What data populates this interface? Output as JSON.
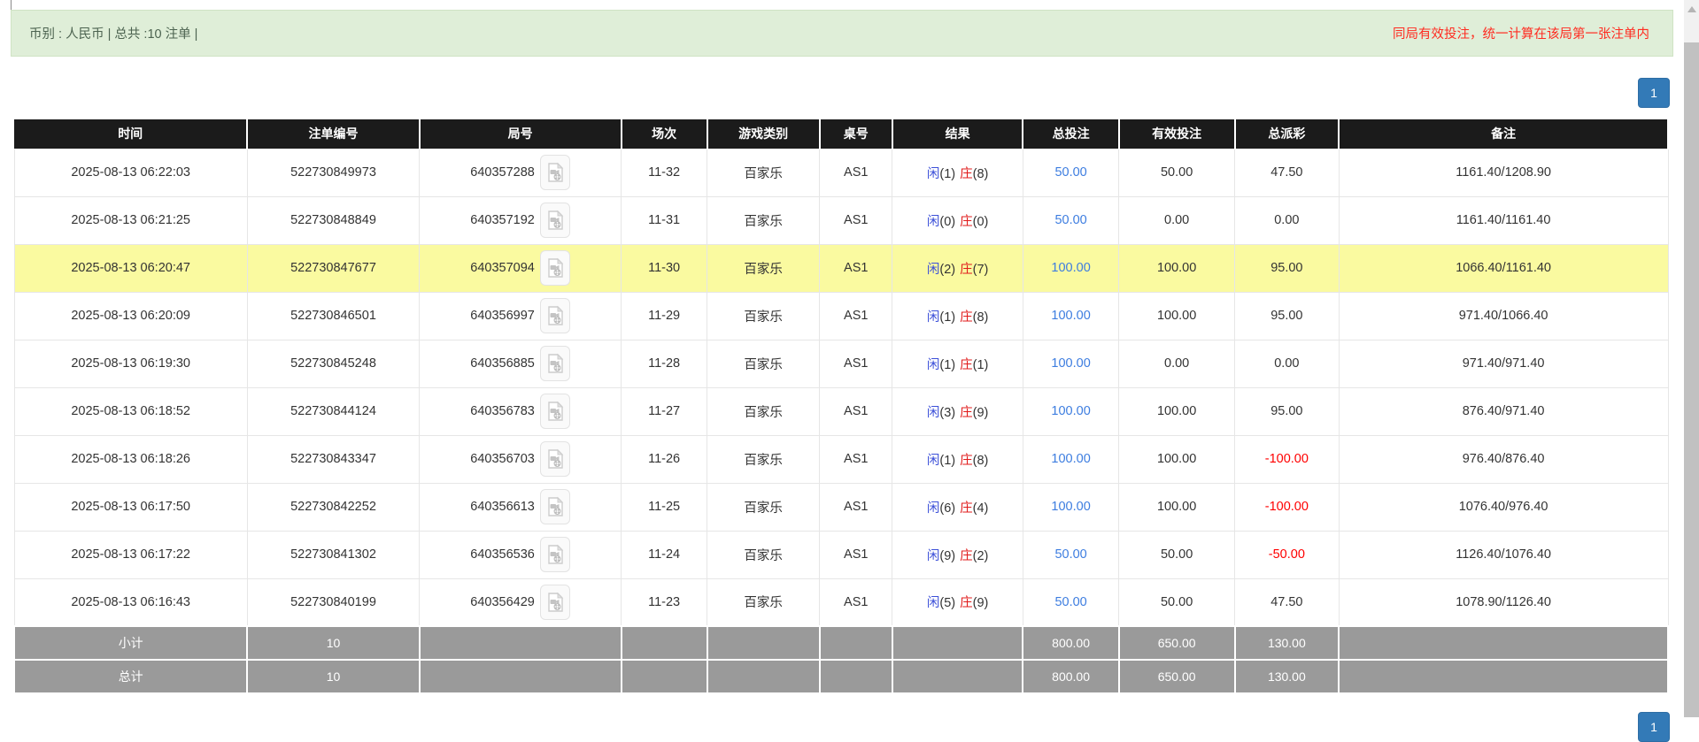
{
  "banner": {
    "left_text": "币别 : 人民币 | 总共 :10 注单 |",
    "right_notice": "同局有效投注，统一计算在该局第一张注单内"
  },
  "pagination": {
    "page": "1"
  },
  "table": {
    "headers": [
      "时间",
      "注单编号",
      "局号",
      "场次",
      "游戏类别",
      "桌号",
      "结果",
      "总投注",
      "有效投注",
      "总派彩",
      "备注"
    ],
    "rows": [
      {
        "time": "2025-08-13 06:22:03",
        "bet_id": "522730849973",
        "round_id": "640357288",
        "session": "11-32",
        "game_type": "百家乐",
        "table_id": "AS1",
        "player": "闲",
        "player_score": "(1)",
        "banker": "庄",
        "banker_score": "(8)",
        "total_bet": "50.00",
        "valid_bet": "50.00",
        "payout": "47.50",
        "remark": "1161.40/1208.90",
        "highlighted": false
      },
      {
        "time": "2025-08-13 06:21:25",
        "bet_id": "522730848849",
        "round_id": "640357192",
        "session": "11-31",
        "game_type": "百家乐",
        "table_id": "AS1",
        "player": "闲",
        "player_score": "(0)",
        "banker": "庄",
        "banker_score": "(0)",
        "total_bet": "50.00",
        "valid_bet": "0.00",
        "payout": "0.00",
        "remark": "1161.40/1161.40",
        "highlighted": false
      },
      {
        "time": "2025-08-13 06:20:47",
        "bet_id": "522730847677",
        "round_id": "640357094",
        "session": "11-30",
        "game_type": "百家乐",
        "table_id": "AS1",
        "player": "闲",
        "player_score": "(2)",
        "banker": "庄",
        "banker_score": "(7)",
        "total_bet": "100.00",
        "valid_bet": "100.00",
        "payout": "95.00",
        "remark": "1066.40/1161.40",
        "highlighted": true
      },
      {
        "time": "2025-08-13 06:20:09",
        "bet_id": "522730846501",
        "round_id": "640356997",
        "session": "11-29",
        "game_type": "百家乐",
        "table_id": "AS1",
        "player": "闲",
        "player_score": "(1)",
        "banker": "庄",
        "banker_score": "(8)",
        "total_bet": "100.00",
        "valid_bet": "100.00",
        "payout": "95.00",
        "remark": "971.40/1066.40",
        "highlighted": false
      },
      {
        "time": "2025-08-13 06:19:30",
        "bet_id": "522730845248",
        "round_id": "640356885",
        "session": "11-28",
        "game_type": "百家乐",
        "table_id": "AS1",
        "player": "闲",
        "player_score": "(1)",
        "banker": "庄",
        "banker_score": "(1)",
        "total_bet": "100.00",
        "valid_bet": "0.00",
        "payout": "0.00",
        "remark": "971.40/971.40",
        "highlighted": false
      },
      {
        "time": "2025-08-13 06:18:52",
        "bet_id": "522730844124",
        "round_id": "640356783",
        "session": "11-27",
        "game_type": "百家乐",
        "table_id": "AS1",
        "player": "闲",
        "player_score": "(3)",
        "banker": "庄",
        "banker_score": "(9)",
        "total_bet": "100.00",
        "valid_bet": "100.00",
        "payout": "95.00",
        "remark": "876.40/971.40",
        "highlighted": false
      },
      {
        "time": "2025-08-13 06:18:26",
        "bet_id": "522730843347",
        "round_id": "640356703",
        "session": "11-26",
        "game_type": "百家乐",
        "table_id": "AS1",
        "player": "闲",
        "player_score": "(1)",
        "banker": "庄",
        "banker_score": "(8)",
        "total_bet": "100.00",
        "valid_bet": "100.00",
        "payout": "-100.00",
        "remark": "976.40/876.40",
        "highlighted": false
      },
      {
        "time": "2025-08-13 06:17:50",
        "bet_id": "522730842252",
        "round_id": "640356613",
        "session": "11-25",
        "game_type": "百家乐",
        "table_id": "AS1",
        "player": "闲",
        "player_score": "(6)",
        "banker": "庄",
        "banker_score": "(4)",
        "total_bet": "100.00",
        "valid_bet": "100.00",
        "payout": "-100.00",
        "remark": "1076.40/976.40",
        "highlighted": false
      },
      {
        "time": "2025-08-13 06:17:22",
        "bet_id": "522730841302",
        "round_id": "640356536",
        "session": "11-24",
        "game_type": "百家乐",
        "table_id": "AS1",
        "player": "闲",
        "player_score": "(9)",
        "banker": "庄",
        "banker_score": "(2)",
        "total_bet": "50.00",
        "valid_bet": "50.00",
        "payout": "-50.00",
        "remark": "1126.40/1076.40",
        "highlighted": false
      },
      {
        "time": "2025-08-13 06:16:43",
        "bet_id": "522730840199",
        "round_id": "640356429",
        "session": "11-23",
        "game_type": "百家乐",
        "table_id": "AS1",
        "player": "闲",
        "player_score": "(5)",
        "banker": "庄",
        "banker_score": "(9)",
        "total_bet": "50.00",
        "valid_bet": "50.00",
        "payout": "47.50",
        "remark": "1078.90/1126.40",
        "highlighted": false
      }
    ],
    "subtotal": {
      "label": "小计",
      "count": "10",
      "total_bet": "800.00",
      "valid_bet": "650.00",
      "payout": "130.00"
    },
    "total": {
      "label": "总计",
      "count": "10",
      "total_bet": "800.00",
      "valid_bet": "650.00",
      "payout": "130.00"
    }
  },
  "colors": {
    "banner_bg": "#dfeed8",
    "notice_red": "#ff2b20",
    "header_bg": "#1b1b1b",
    "highlight_yellow": "#fafaa0",
    "summary_gray": "#9a9a9a",
    "link_blue": "#3d7de0",
    "player_blue": "#3b4fd8",
    "banker_red": "#e01b1b",
    "negative_red": "#ff0000",
    "pagination_blue": "#337ab7"
  }
}
